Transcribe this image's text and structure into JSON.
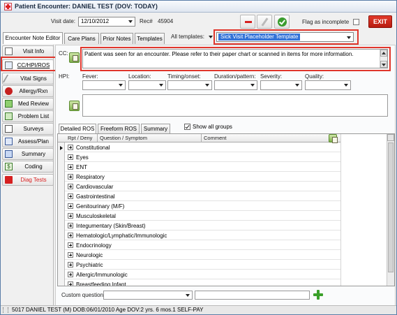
{
  "window": {
    "title": "Patient Encounter: DANIEL TEST (DOV: TODAY)"
  },
  "header": {
    "visit_date_label": "Visit date:",
    "visit_date_value": "12/10/2012",
    "rec_label": "Rec#",
    "rec_value": "45904",
    "flag_label": "Flag as incomplete",
    "exit_label": "EXIT"
  },
  "tabs": [
    "Encounter Note Editor",
    "Care Plans",
    "Prior Notes",
    "Templates"
  ],
  "all_templates": {
    "label": "All templates:",
    "selected": "Sick Visit Placeholder Template"
  },
  "nav": [
    {
      "label": "Visit Info",
      "icon": "visit-info-icon"
    },
    {
      "label": "CC/HPI/ROS",
      "icon": "cc-hpi-icon"
    },
    {
      "label": "Vital Signs",
      "icon": "vital-signs-icon"
    },
    {
      "label": "Allergy/Rxn",
      "icon": "allergy-icon"
    },
    {
      "label": "Med Review",
      "icon": "med-review-icon"
    },
    {
      "label": "Problem List",
      "icon": "problem-list-icon"
    },
    {
      "label": "Surveys",
      "icon": "surveys-icon"
    },
    {
      "label": "Assess/Plan",
      "icon": "assess-plan-icon"
    },
    {
      "label": "Summary",
      "icon": "summary-icon"
    },
    {
      "label": "Coding",
      "icon": "coding-icon"
    },
    {
      "label": "Diag Tests",
      "icon": "diag-tests-icon"
    }
  ],
  "cc": {
    "label": "CC:",
    "text": "Patient was seen for an encounter. Please refer to their paper chart or scanned in items for more information."
  },
  "hpi": {
    "label": "HPI:",
    "fields": [
      "Fever:",
      "Location:",
      "Timing/onset:",
      "Duration/pattern:",
      "Severity:",
      "Quality:"
    ]
  },
  "ros": {
    "tabs": [
      "Detailed ROS",
      "Freeform ROS",
      "Summary"
    ],
    "show_all_label": "Show all groups",
    "headers": [
      "Rpt / Deny",
      "Question / Symptom",
      "Comment"
    ],
    "rows": [
      "Constitutional",
      "Eyes",
      "ENT",
      "Respiratory",
      "Cardiovascular",
      "Gastrointestinal",
      "Genitourinary (M/F)",
      "Musculoskeletal",
      "Integumentary (Skin/Breast)",
      "Hematologic/Lymphatic/Immunologic",
      "Endocrinology",
      "Neurologic",
      "Psychiatric",
      "Allergic/Immunologic",
      "Breastfeeding Infant"
    ]
  },
  "custom_question": {
    "label": "Custom question:"
  },
  "status": {
    "text": "5017 DANIEL TEST (M) DOB:06/01/2010  Age DOV:2 yrs. 6 mos.1 SELF-PAY"
  },
  "colors": {
    "accent": "#3373d8",
    "exit": "#c8281a",
    "highlight": "#e0362c"
  }
}
